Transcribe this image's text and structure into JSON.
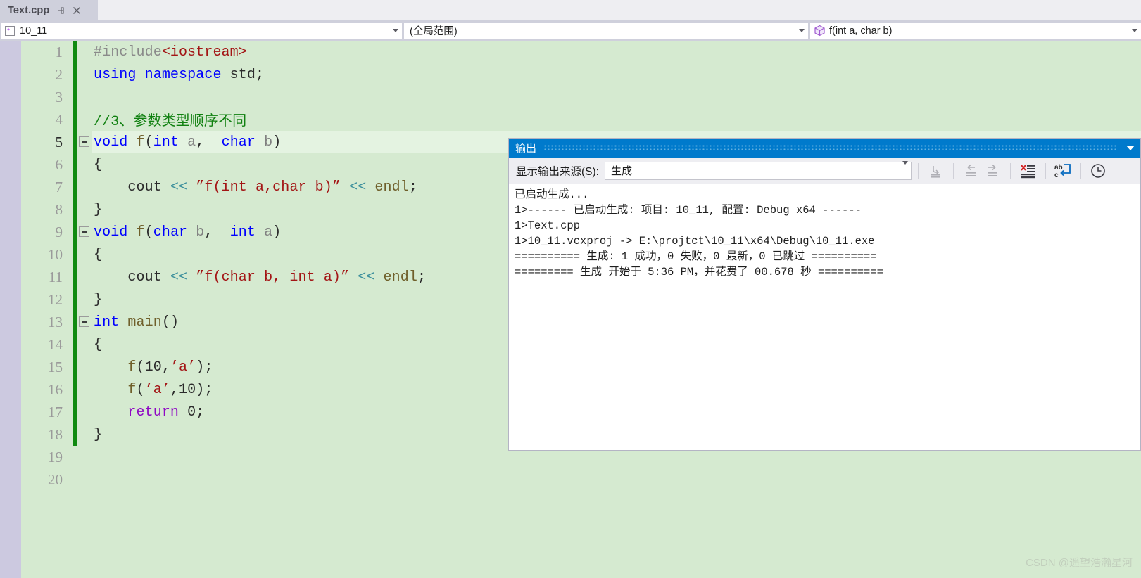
{
  "window": {
    "tab": {
      "title": "Text.cpp",
      "pin_icon": "pin-icon",
      "close_icon": "close-icon"
    }
  },
  "navbar": {
    "project_combo": {
      "icon": "project-cpp-icon",
      "value": "10_11",
      "arrow_icon": "chevron-down-icon"
    },
    "scope_combo": {
      "value": "(全局范围)",
      "arrow_icon": "chevron-down-icon"
    },
    "member_combo": {
      "icon": "function-cube-icon",
      "value": "f(int a, char b)",
      "arrow_icon": "chevron-down-icon"
    }
  },
  "editor": {
    "current_line": 5,
    "colors": {
      "background": "#d5ead0",
      "current_line": "#e4f3e1",
      "gutter": "#ccc9e0",
      "saved_changebar": "#108a10",
      "keyword": "#0000ff",
      "comment": "#108010",
      "string": "#a31515",
      "operator": "#3c8f9c",
      "preprocessor": "#8a8a8a",
      "control_keyword": "#8f08c4",
      "identifier_gray": "#808080"
    },
    "lines": [
      {
        "num": "1",
        "saved": true,
        "fold": "none",
        "tokens": [
          {
            "t": "#include",
            "c": "t-pp"
          },
          {
            "t": "<iostream>",
            "c": "t-inc"
          }
        ]
      },
      {
        "num": "2",
        "saved": true,
        "fold": "none",
        "tokens": [
          {
            "t": "using",
            "c": "t-kw"
          },
          {
            "t": " ",
            "c": "t-plain"
          },
          {
            "t": "namespace",
            "c": "t-kw"
          },
          {
            "t": " std;",
            "c": "t-plain"
          }
        ]
      },
      {
        "num": "3",
        "saved": true,
        "fold": "none",
        "tokens": []
      },
      {
        "num": "4",
        "saved": true,
        "fold": "none",
        "tokens": [
          {
            "t": "//3、参数类型顺序不同",
            "c": "t-com"
          }
        ]
      },
      {
        "num": "5",
        "saved": true,
        "fold": "box",
        "tokens": [
          {
            "t": "void",
            "c": "t-kw"
          },
          {
            "t": " ",
            "c": "t-plain"
          },
          {
            "t": "f",
            "c": "t-fn"
          },
          {
            "t": "(",
            "c": "t-plain"
          },
          {
            "t": "int",
            "c": "t-kw"
          },
          {
            "t": " ",
            "c": "t-plain"
          },
          {
            "t": "a",
            "c": "t-var"
          },
          {
            "t": ",  ",
            "c": "t-plain"
          },
          {
            "t": "char",
            "c": "t-kw"
          },
          {
            "t": " ",
            "c": "t-plain"
          },
          {
            "t": "b",
            "c": "t-var"
          },
          {
            "t": ")",
            "c": "t-plain"
          }
        ]
      },
      {
        "num": "6",
        "saved": true,
        "fold": "line",
        "tokens": [
          {
            "t": "{",
            "c": "t-plain"
          }
        ]
      },
      {
        "num": "7",
        "saved": true,
        "fold": "line",
        "indent": true,
        "tokens": [
          {
            "t": "    cout ",
            "c": "t-plain"
          },
          {
            "t": "<<",
            "c": "t-op"
          },
          {
            "t": " ",
            "c": "t-plain"
          },
          {
            "t": "”f(int a,char b)”",
            "c": "t-str"
          },
          {
            "t": " ",
            "c": "t-plain"
          },
          {
            "t": "<<",
            "c": "t-op"
          },
          {
            "t": " ",
            "c": "t-plain"
          },
          {
            "t": "endl",
            "c": "t-fn"
          },
          {
            "t": ";",
            "c": "t-plain"
          }
        ]
      },
      {
        "num": "8",
        "saved": true,
        "fold": "end",
        "tokens": [
          {
            "t": "}",
            "c": "t-plain"
          }
        ]
      },
      {
        "num": "9",
        "saved": true,
        "fold": "box",
        "tokens": [
          {
            "t": "void",
            "c": "t-kw"
          },
          {
            "t": " ",
            "c": "t-plain"
          },
          {
            "t": "f",
            "c": "t-fn"
          },
          {
            "t": "(",
            "c": "t-plain"
          },
          {
            "t": "char",
            "c": "t-kw"
          },
          {
            "t": " ",
            "c": "t-plain"
          },
          {
            "t": "b",
            "c": "t-var"
          },
          {
            "t": ",  ",
            "c": "t-plain"
          },
          {
            "t": "int",
            "c": "t-kw"
          },
          {
            "t": " ",
            "c": "t-plain"
          },
          {
            "t": "a",
            "c": "t-var"
          },
          {
            "t": ")",
            "c": "t-plain"
          }
        ]
      },
      {
        "num": "10",
        "saved": true,
        "fold": "line",
        "tokens": [
          {
            "t": "{",
            "c": "t-plain"
          }
        ]
      },
      {
        "num": "11",
        "saved": true,
        "fold": "line",
        "indent": true,
        "tokens": [
          {
            "t": "    cout ",
            "c": "t-plain"
          },
          {
            "t": "<<",
            "c": "t-op"
          },
          {
            "t": " ",
            "c": "t-plain"
          },
          {
            "t": "”f(char b, int a)”",
            "c": "t-str"
          },
          {
            "t": " ",
            "c": "t-plain"
          },
          {
            "t": "<<",
            "c": "t-op"
          },
          {
            "t": " ",
            "c": "t-plain"
          },
          {
            "t": "endl",
            "c": "t-fn"
          },
          {
            "t": ";",
            "c": "t-plain"
          }
        ]
      },
      {
        "num": "12",
        "saved": true,
        "fold": "end",
        "tokens": [
          {
            "t": "}",
            "c": "t-plain"
          }
        ]
      },
      {
        "num": "13",
        "saved": true,
        "fold": "box",
        "tokens": [
          {
            "t": "int",
            "c": "t-kw"
          },
          {
            "t": " ",
            "c": "t-plain"
          },
          {
            "t": "main",
            "c": "t-fn"
          },
          {
            "t": "()",
            "c": "t-plain"
          }
        ]
      },
      {
        "num": "14",
        "saved": true,
        "fold": "line",
        "tokens": [
          {
            "t": "{",
            "c": "t-plain"
          }
        ]
      },
      {
        "num": "15",
        "saved": true,
        "fold": "line",
        "indent": true,
        "tokens": [
          {
            "t": "    ",
            "c": "t-plain"
          },
          {
            "t": "f",
            "c": "t-fn"
          },
          {
            "t": "(10,",
            "c": "t-plain"
          },
          {
            "t": "’a’",
            "c": "t-str"
          },
          {
            "t": ");",
            "c": "t-plain"
          }
        ]
      },
      {
        "num": "16",
        "saved": true,
        "fold": "line",
        "indent": true,
        "tokens": [
          {
            "t": "    ",
            "c": "t-plain"
          },
          {
            "t": "f",
            "c": "t-fn"
          },
          {
            "t": "(",
            "c": "t-plain"
          },
          {
            "t": "’a’",
            "c": "t-str"
          },
          {
            "t": ",10);",
            "c": "t-plain"
          }
        ]
      },
      {
        "num": "17",
        "saved": true,
        "fold": "line",
        "indent": true,
        "tokens": [
          {
            "t": "    ",
            "c": "t-plain"
          },
          {
            "t": "return",
            "c": "t-kw2"
          },
          {
            "t": " 0;",
            "c": "t-plain"
          }
        ]
      },
      {
        "num": "18",
        "saved": true,
        "fold": "end",
        "tokens": [
          {
            "t": "}",
            "c": "t-plain"
          }
        ]
      },
      {
        "num": "19",
        "saved": false,
        "fold": "none",
        "tokens": []
      },
      {
        "num": "20",
        "saved": false,
        "fold": "none",
        "tokens": []
      }
    ]
  },
  "output_window": {
    "title": "输出",
    "collapse_icon": "chevron-down-icon",
    "source_label": "显示输出来源(S):",
    "source_label_pre": "显示输出来源(",
    "source_label_key": "S",
    "source_label_post": "):",
    "source_value": "生成",
    "source_arrow_icon": "chevron-down-icon",
    "toolbar_buttons": [
      {
        "name": "go-to-message-icon",
        "disabled": true
      },
      {
        "name": "previous-message-icon",
        "disabled": true
      },
      {
        "name": "next-message-icon",
        "disabled": true
      },
      {
        "name": "clear-all-icon",
        "disabled": false
      },
      {
        "name": "toggle-word-wrap-icon",
        "disabled": false
      },
      {
        "name": "show-timestamps-icon",
        "disabled": false
      }
    ],
    "lines": [
      "已启动生成...",
      "1>------ 已启动生成: 项目: 10_11, 配置: Debug x64 ------",
      "1>Text.cpp",
      "1>10_11.vcxproj -> E:\\projtct\\10_11\\x64\\Debug\\10_11.exe",
      "========== 生成: 1 成功，0 失败，0 最新，0 已跳过 ==========",
      "========= 生成 开始于 5:36 PM，并花费了 00.678 秒 =========="
    ],
    "accent_color": "#007acc"
  },
  "watermark": "CSDN @遥望浩瀚星河"
}
